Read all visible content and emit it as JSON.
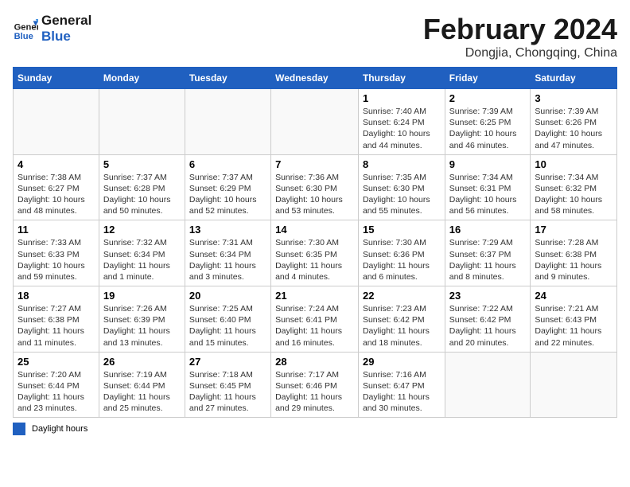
{
  "logo": {
    "line1": "General",
    "line2": "Blue"
  },
  "title": "February 2024",
  "location": "Dongjia, Chongqing, China",
  "days_of_week": [
    "Sunday",
    "Monday",
    "Tuesday",
    "Wednesday",
    "Thursday",
    "Friday",
    "Saturday"
  ],
  "legend_label": "Daylight hours",
  "weeks": [
    [
      {
        "day": "",
        "info": ""
      },
      {
        "day": "",
        "info": ""
      },
      {
        "day": "",
        "info": ""
      },
      {
        "day": "",
        "info": ""
      },
      {
        "day": "1",
        "info": "Sunrise: 7:40 AM\nSunset: 6:24 PM\nDaylight: 10 hours\nand 44 minutes."
      },
      {
        "day": "2",
        "info": "Sunrise: 7:39 AM\nSunset: 6:25 PM\nDaylight: 10 hours\nand 46 minutes."
      },
      {
        "day": "3",
        "info": "Sunrise: 7:39 AM\nSunset: 6:26 PM\nDaylight: 10 hours\nand 47 minutes."
      }
    ],
    [
      {
        "day": "4",
        "info": "Sunrise: 7:38 AM\nSunset: 6:27 PM\nDaylight: 10 hours\nand 48 minutes."
      },
      {
        "day": "5",
        "info": "Sunrise: 7:37 AM\nSunset: 6:28 PM\nDaylight: 10 hours\nand 50 minutes."
      },
      {
        "day": "6",
        "info": "Sunrise: 7:37 AM\nSunset: 6:29 PM\nDaylight: 10 hours\nand 52 minutes."
      },
      {
        "day": "7",
        "info": "Sunrise: 7:36 AM\nSunset: 6:30 PM\nDaylight: 10 hours\nand 53 minutes."
      },
      {
        "day": "8",
        "info": "Sunrise: 7:35 AM\nSunset: 6:30 PM\nDaylight: 10 hours\nand 55 minutes."
      },
      {
        "day": "9",
        "info": "Sunrise: 7:34 AM\nSunset: 6:31 PM\nDaylight: 10 hours\nand 56 minutes."
      },
      {
        "day": "10",
        "info": "Sunrise: 7:34 AM\nSunset: 6:32 PM\nDaylight: 10 hours\nand 58 minutes."
      }
    ],
    [
      {
        "day": "11",
        "info": "Sunrise: 7:33 AM\nSunset: 6:33 PM\nDaylight: 10 hours\nand 59 minutes."
      },
      {
        "day": "12",
        "info": "Sunrise: 7:32 AM\nSunset: 6:34 PM\nDaylight: 11 hours\nand 1 minute."
      },
      {
        "day": "13",
        "info": "Sunrise: 7:31 AM\nSunset: 6:34 PM\nDaylight: 11 hours\nand 3 minutes."
      },
      {
        "day": "14",
        "info": "Sunrise: 7:30 AM\nSunset: 6:35 PM\nDaylight: 11 hours\nand 4 minutes."
      },
      {
        "day": "15",
        "info": "Sunrise: 7:30 AM\nSunset: 6:36 PM\nDaylight: 11 hours\nand 6 minutes."
      },
      {
        "day": "16",
        "info": "Sunrise: 7:29 AM\nSunset: 6:37 PM\nDaylight: 11 hours\nand 8 minutes."
      },
      {
        "day": "17",
        "info": "Sunrise: 7:28 AM\nSunset: 6:38 PM\nDaylight: 11 hours\nand 9 minutes."
      }
    ],
    [
      {
        "day": "18",
        "info": "Sunrise: 7:27 AM\nSunset: 6:38 PM\nDaylight: 11 hours\nand 11 minutes."
      },
      {
        "day": "19",
        "info": "Sunrise: 7:26 AM\nSunset: 6:39 PM\nDaylight: 11 hours\nand 13 minutes."
      },
      {
        "day": "20",
        "info": "Sunrise: 7:25 AM\nSunset: 6:40 PM\nDaylight: 11 hours\nand 15 minutes."
      },
      {
        "day": "21",
        "info": "Sunrise: 7:24 AM\nSunset: 6:41 PM\nDaylight: 11 hours\nand 16 minutes."
      },
      {
        "day": "22",
        "info": "Sunrise: 7:23 AM\nSunset: 6:42 PM\nDaylight: 11 hours\nand 18 minutes."
      },
      {
        "day": "23",
        "info": "Sunrise: 7:22 AM\nSunset: 6:42 PM\nDaylight: 11 hours\nand 20 minutes."
      },
      {
        "day": "24",
        "info": "Sunrise: 7:21 AM\nSunset: 6:43 PM\nDaylight: 11 hours\nand 22 minutes."
      }
    ],
    [
      {
        "day": "25",
        "info": "Sunrise: 7:20 AM\nSunset: 6:44 PM\nDaylight: 11 hours\nand 23 minutes."
      },
      {
        "day": "26",
        "info": "Sunrise: 7:19 AM\nSunset: 6:44 PM\nDaylight: 11 hours\nand 25 minutes."
      },
      {
        "day": "27",
        "info": "Sunrise: 7:18 AM\nSunset: 6:45 PM\nDaylight: 11 hours\nand 27 minutes."
      },
      {
        "day": "28",
        "info": "Sunrise: 7:17 AM\nSunset: 6:46 PM\nDaylight: 11 hours\nand 29 minutes."
      },
      {
        "day": "29",
        "info": "Sunrise: 7:16 AM\nSunset: 6:47 PM\nDaylight: 11 hours\nand 30 minutes."
      },
      {
        "day": "",
        "info": ""
      },
      {
        "day": "",
        "info": ""
      }
    ]
  ]
}
